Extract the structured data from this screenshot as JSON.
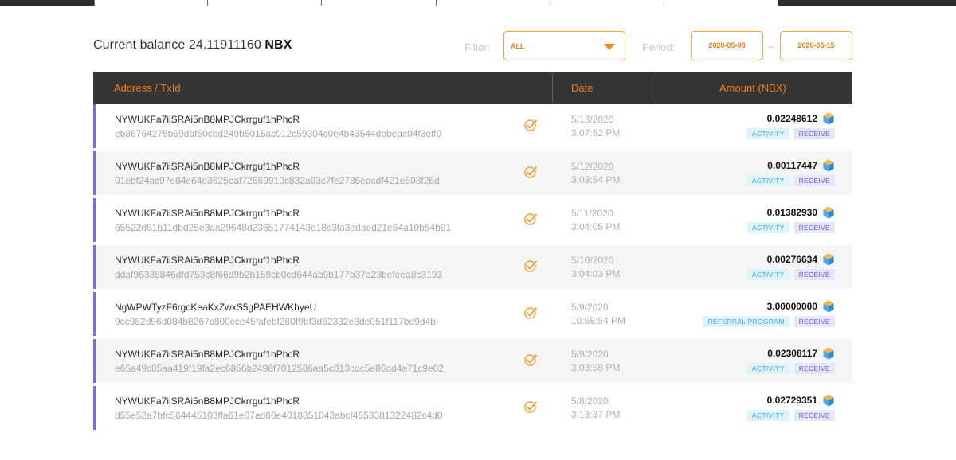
{
  "balance": {
    "prefix": "Current balance 24.11911160",
    "currency": "NBX"
  },
  "filter": {
    "label": "Filter:",
    "selected": "ALL"
  },
  "period": {
    "label": "Period:",
    "from": "2020-05-08",
    "separator": "–",
    "to": "2020-05-15"
  },
  "table": {
    "headers": {
      "address": "Address / TxId",
      "date": "Date",
      "amount": "Amount (NBX)"
    },
    "rows": [
      {
        "address": "NYWUKFa7iiSRAi5nB8MPJCkrrguf1hPhcR",
        "txid": "eb86764275b59dbf50cbd249b5015ac912c59304c0e4b43544dbbeac04f3eff0",
        "date": "5/13/2020",
        "time": "3:07:52 PM",
        "amount": "0.02248612",
        "type": "ACTIVITY",
        "direction": "RECEIVE"
      },
      {
        "address": "NYWUKFa7iiSRAi5nB8MPJCkrrguf1hPhcR",
        "txid": "01ebf24ac97e84e64e3625eaf72569910c832a93c7fe2786eacdf421e508f26d",
        "date": "5/12/2020",
        "time": "3:03:54 PM",
        "amount": "0.00117447",
        "type": "ACTIVITY",
        "direction": "RECEIVE"
      },
      {
        "address": "NYWUKFa7iiSRAi5nB8MPJCkrrguf1hPhcR",
        "txid": "65522d81b11dbd25e3da29648d23651774143e18c3fa3edaed21e64a10b54b91",
        "date": "5/11/2020",
        "time": "3:04:05 PM",
        "amount": "0.01382930",
        "type": "ACTIVITY",
        "direction": "RECEIVE"
      },
      {
        "address": "NYWUKFa7iiSRAi5nB8MPJCkrrguf1hPhcR",
        "txid": "ddaf96335846dfd753c8f66d9b2b159cb0cd644ab9b177b37a23befeea8c3193",
        "date": "5/10/2020",
        "time": "3:04:03 PM",
        "amount": "0.00276634",
        "type": "ACTIVITY",
        "direction": "RECEIVE"
      },
      {
        "address": "NgWPWTyzF6rgcKeaKxZwxS5gPAEHWKhyeU",
        "txid": "9cc982d96d084b8267c800cce45fafebf280f9bf3d62332e3de051f117bd9d4b",
        "date": "5/9/2020",
        "time": "10:59:54 PM",
        "amount": "3.00000000",
        "type": "REFERRAL PROGRAM",
        "direction": "RECEIVE"
      },
      {
        "address": "NYWUKFa7iiSRAi5nB8MPJCkrrguf1hPhcR",
        "txid": "e65a49c85aa419f19fa2ec6856b2498f7012586aa5c813cdc5e86dd4a71c9e02",
        "date": "5/9/2020",
        "time": "3:03:58 PM",
        "amount": "0.02308117",
        "type": "ACTIVITY",
        "direction": "RECEIVE"
      },
      {
        "address": "NYWUKFa7iiSRAi5nB8MPJCkrrguf1hPhcR",
        "txid": "d55e52a7bfc564445103ffa61e07ad60e4018851043abcf4553381322482c4d0",
        "date": "5/8/2020",
        "time": "3:13:37 PM",
        "amount": "0.02729351",
        "type": "ACTIVITY",
        "direction": "RECEIVE"
      }
    ]
  },
  "icons": {
    "status": "check-circle-icon",
    "coin": "nbx-coin-icon",
    "dropdown": "chevron-down-icon"
  },
  "colors": {
    "accent": "#f07d14",
    "header_bg": "#353535",
    "row_marker": "#7b6be0"
  }
}
